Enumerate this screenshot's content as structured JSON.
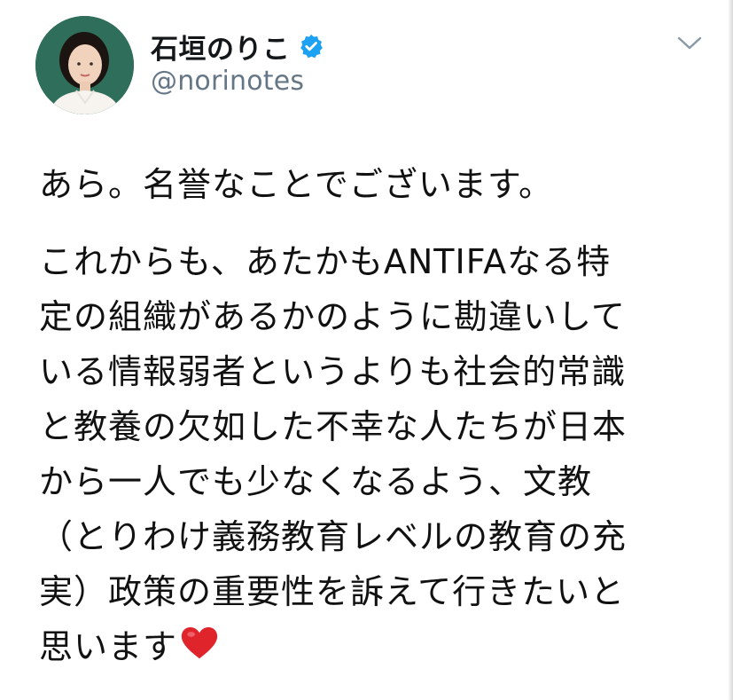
{
  "user": {
    "display_name": "石垣のりこ",
    "handle": "@norinotes",
    "verified": true,
    "avatar_icon": "profile-photo"
  },
  "tweet": {
    "paragraph1": "あら。名誉なことでございます。",
    "paragraph2_lines": [
      "これからも、あたかもANTIFAなる特",
      "定の組織があるかのように勘違いして",
      "いる情報弱者というよりも社会的常識",
      "と教養の欠如した不幸な人たちが日本",
      "から一人でも少なくなるよう、文教",
      "（とりわけ義務教育レベルの教育の充",
      "実）政策の重要性を訴えて行きたいと",
      "思います"
    ],
    "emoji": "heart-emoji"
  },
  "menu": {
    "icon": "chevron-down-icon"
  },
  "colors": {
    "verified_blue": "#1da1f2",
    "handle_gray": "#657786",
    "heart_red": "#e0242c",
    "avatar_bg": "#2f6e5a"
  }
}
